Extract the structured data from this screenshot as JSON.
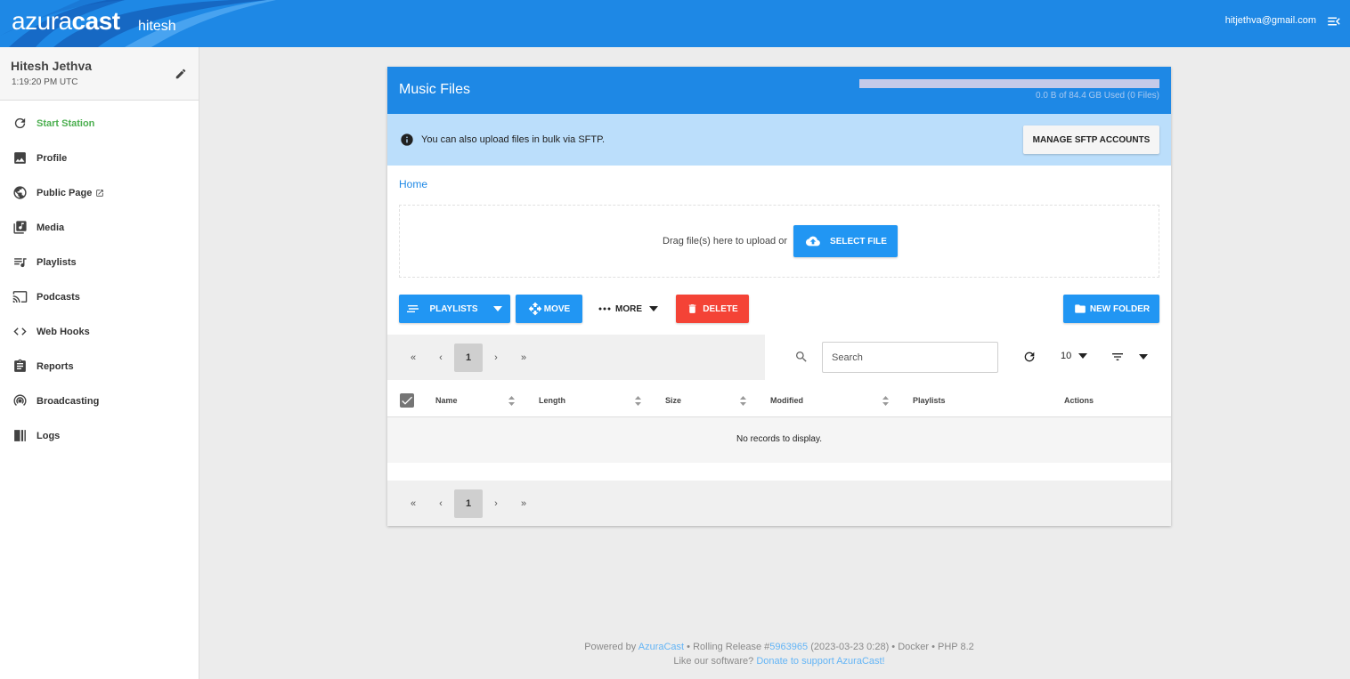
{
  "header": {
    "brand_light": "azura",
    "brand_bold": "cast",
    "station": "hitesh",
    "user_email": "hitjethva@gmail.com",
    "accent": "#1e88e5"
  },
  "sidebar": {
    "user_name": "Hitesh Jethva",
    "time": "1:19:20 PM UTC",
    "items": [
      {
        "label": "Start Station",
        "icon": "refresh-icon",
        "active_color": "#4caf50"
      },
      {
        "label": "Profile",
        "icon": "image-icon"
      },
      {
        "label": "Public Page",
        "icon": "globe-icon"
      },
      {
        "label": "Media",
        "icon": "music-library-icon"
      },
      {
        "label": "Playlists",
        "icon": "queue-music-icon"
      },
      {
        "label": "Podcasts",
        "icon": "cast-icon"
      },
      {
        "label": "Web Hooks",
        "icon": "code-icon"
      },
      {
        "label": "Reports",
        "icon": "assignment-icon"
      },
      {
        "label": "Broadcasting",
        "icon": "podcasts-icon"
      },
      {
        "label": "Logs",
        "icon": "logs-icon"
      }
    ]
  },
  "card": {
    "title": "Music Files",
    "quota_text": "0.0 B of 84.4 GB Used (0 Files)",
    "quota_used_fraction": 0,
    "info_text": "You can also upload files in bulk via SFTP.",
    "sftp_button": "MANAGE SFTP ACCOUNTS",
    "breadcrumb_home": "Home",
    "drop_text": "Drag file(s) here to upload or",
    "select_file_button": "SELECT FILE",
    "toolbar": {
      "playlists": "PLAYLISTS",
      "move": "MOVE",
      "more": "MORE",
      "delete": "DELETE",
      "new_folder": "NEW FOLDER"
    },
    "pager": {
      "first": "«",
      "prev": "‹",
      "current": "1",
      "next": "›",
      "last": "»"
    },
    "search_placeholder": "Search",
    "per_page": "10",
    "columns": [
      "Name",
      "Length",
      "Size",
      "Modified",
      "Playlists",
      "Actions"
    ],
    "empty_text": "No records to display."
  },
  "footer": {
    "powered_by": "Powered by",
    "azuracast_link": "AzuraCast",
    "release_prefix": "• Rolling Release #",
    "commit_link": "5963965",
    "release_suffix": "(2023-03-23 0:28) • Docker • PHP 8.2",
    "like_text": "Like our software?",
    "donate_link": "Donate to support AzuraCast!"
  }
}
